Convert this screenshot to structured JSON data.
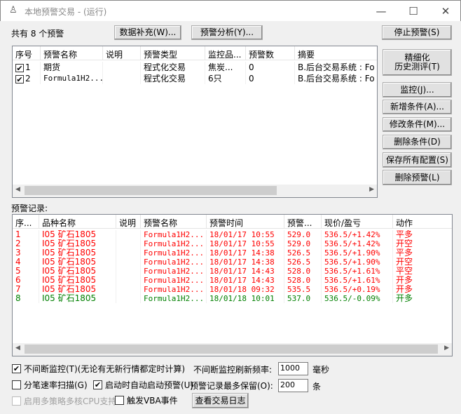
{
  "window": {
    "title": "本地预警交易 - (运行)",
    "minimize": "—",
    "maximize": "☐",
    "close": "✕"
  },
  "summary": "共有 8 个预警",
  "toolbar": {
    "data_fill": "数据补充(W)...",
    "analysis": "预警分析(Y)...",
    "stop": "停止预警(S)"
  },
  "side_buttons": {
    "backtest_line1": "精细化",
    "backtest_line2": "历史测评(T)",
    "monitor": "监控(J)...",
    "add_cond": "新增条件(A)...",
    "edit_cond": "修改条件(M)...",
    "delete_cond": "删除条件(D)",
    "save_all": "保存所有配置(S)",
    "delete_alert": "删除预警(L)"
  },
  "alerts": {
    "columns": [
      "序号",
      "预警名称",
      "说明",
      "预警类型",
      "监控品...",
      "预警数",
      "摘要"
    ],
    "rows": [
      {
        "checked": true,
        "no": "1",
        "name": "期货",
        "desc": "",
        "type": "程式化交易",
        "target": "焦炭...",
        "count": "0",
        "summary": "B.后台交易系统 : Fo"
      },
      {
        "checked": true,
        "no": "2",
        "name": "Formula1H2...",
        "desc": "",
        "type": "程式化交易",
        "target": "6只",
        "count": "0",
        "summary": "B.后台交易系统 : Fo"
      }
    ]
  },
  "records_label": "预警记录:",
  "records": {
    "columns": [
      "序...",
      "品种名称",
      "说明",
      "预警名称",
      "预警时间",
      "预警...",
      "现价/盈亏",
      "动作"
    ],
    "rows": [
      {
        "no": "1",
        "symbol": "I05 矿石1805",
        "desc": "",
        "name": "Formula1H2...",
        "time": "18/01/17 10:55",
        "price": "529.0",
        "pnl": "536.5/+1.42%",
        "action": "平多",
        "color": "red"
      },
      {
        "no": "2",
        "symbol": "I05 矿石1805",
        "desc": "",
        "name": "Formula1H2...",
        "time": "18/01/17 10:55",
        "price": "529.0",
        "pnl": "536.5/+1.42%",
        "action": "开空",
        "color": "red"
      },
      {
        "no": "3",
        "symbol": "I05 矿石1805",
        "desc": "",
        "name": "Formula1H2...",
        "time": "18/01/17 14:38",
        "price": "526.5",
        "pnl": "536.5/+1.90%",
        "action": "平多",
        "color": "red"
      },
      {
        "no": "4",
        "symbol": "I05 矿石1805",
        "desc": "",
        "name": "Formula1H2...",
        "time": "18/01/17 14:38",
        "price": "526.5",
        "pnl": "536.5/+1.90%",
        "action": "开空",
        "color": "red"
      },
      {
        "no": "5",
        "symbol": "I05 矿石1805",
        "desc": "",
        "name": "Formula1H2...",
        "time": "18/01/17 14:43",
        "price": "528.0",
        "pnl": "536.5/+1.61%",
        "action": "平空",
        "color": "red"
      },
      {
        "no": "6",
        "symbol": "I05 矿石1805",
        "desc": "",
        "name": "Formula1H2...",
        "time": "18/01/17 14:43",
        "price": "528.0",
        "pnl": "536.5/+1.61%",
        "action": "开多",
        "color": "red"
      },
      {
        "no": "7",
        "symbol": "I05 矿石1805",
        "desc": "",
        "name": "Formula1H2...",
        "time": "18/01/18 09:32",
        "price": "535.5",
        "pnl": "536.5/+0.19%",
        "action": "开多",
        "color": "red"
      },
      {
        "no": "8",
        "symbol": "I05 矿石1805",
        "desc": "",
        "name": "Formula1H2...",
        "time": "18/01/18 10:01",
        "price": "537.0",
        "pnl": "536.5/-0.09%",
        "action": "开多",
        "color": "green"
      }
    ]
  },
  "options": {
    "continuous": {
      "checked": true,
      "label": "不间断监控(T)(无论有无新行情都定时计算)"
    },
    "refresh_label": "不间断监控刷新频率:",
    "refresh_value": "1000",
    "refresh_unit": "毫秒",
    "tick_scan": {
      "checked": false,
      "label": "分笔速率扫描(G)"
    },
    "auto_start": {
      "checked": true,
      "label": "启动时自动启动预警(U)"
    },
    "keep_label": "预警记录最多保留(O):",
    "keep_value": "200",
    "keep_unit": "条",
    "multicore": {
      "checked": false,
      "label": "启用多策略多核CPU支持",
      "disabled": true
    },
    "vba": {
      "checked": false,
      "label": "触发VBA事件"
    },
    "log_button": "查看交易日志"
  },
  "colors": {
    "red": "#ff0000",
    "green": "#008000"
  }
}
